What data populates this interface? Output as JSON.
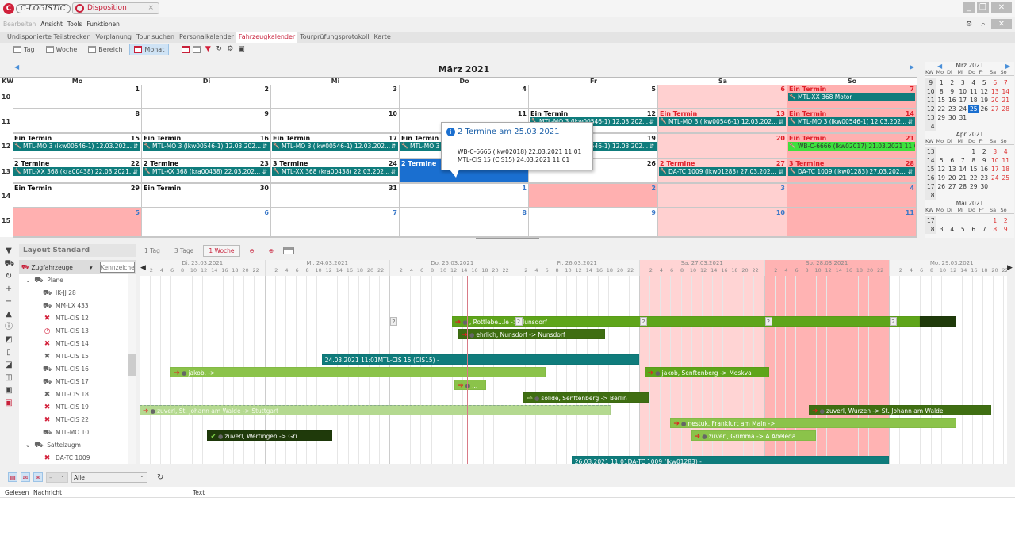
{
  "app": {
    "logo_text": "C-LOGISTIC",
    "document_tab": "Disposition",
    "close_glyph": "×"
  },
  "window_controls": {
    "minimize": "_",
    "restore": "❐",
    "close": "✕",
    "tab_close": "✕"
  },
  "menu": [
    "Bearbeiten",
    "Ansicht",
    "Tools",
    "Funktionen"
  ],
  "tabs": [
    "Undisponierte Teilstrecken",
    "Vorplanung",
    "Tour suchen",
    "Personalkalender",
    "Fahrzeugkalender",
    "Tourprüfungsprotokoll",
    "Karte"
  ],
  "active_tab": "Fahrzeugkalender",
  "toolbar": {
    "views": [
      "Tag",
      "Woche",
      "Bereich",
      "Monat"
    ],
    "active_view": "Monat"
  },
  "calendar": {
    "title": "März 2021",
    "kw_label": "KW",
    "weekdays": [
      "Mo",
      "Di",
      "Mi",
      "Do",
      "Fr",
      "Sa",
      "So"
    ],
    "weeks": [
      {
        "kw": "10",
        "days": [
          {
            "d": "1"
          },
          {
            "d": "2"
          },
          {
            "d": "3"
          },
          {
            "d": "4"
          },
          {
            "d": "5"
          },
          {
            "d": "6",
            "bg": "sat"
          },
          {
            "d": "7",
            "bg": "sun",
            "title": "Ein Termin",
            "event": "MTL-XX 368 Motor",
            "event_kind": "motor"
          }
        ]
      },
      {
        "kw": "11",
        "days": [
          {
            "d": "8"
          },
          {
            "d": "9"
          },
          {
            "d": "10"
          },
          {
            "d": "11"
          },
          {
            "d": "12",
            "title": "Ein Termin",
            "event": "MTL-MO 3 (lkw00546-1) 12.03.202..."
          },
          {
            "d": "13",
            "bg": "sat",
            "title": "Ein Termin",
            "event": "MTL-MO 3 (lkw00546-1) 12.03.202..."
          },
          {
            "d": "14",
            "bg": "sun",
            "title": "Ein Termin",
            "event": "MTL-MO 3 (lkw00546-1) 12.03.202..."
          }
        ]
      },
      {
        "kw": "12",
        "days": [
          {
            "d": "15",
            "title": "Ein Termin",
            "event": "MTL-MO 3 (lkw00546-1) 12.03.202..."
          },
          {
            "d": "16",
            "title": "Ein Termin",
            "event": "MTL-MO 3 (lkw00546-1) 12.03.202..."
          },
          {
            "d": "17",
            "title": "Ein Termin",
            "event": "MTL-MO 3 (lkw00546-1) 12.03.202..."
          },
          {
            "d": "18",
            "title": "Ein Termin",
            "event": "MTL-MO 3 (lkw00546-1) 12.03.202..."
          },
          {
            "d": "19",
            "event": "MTL-MO 3 (lkw00546-1) 12.03.202..."
          },
          {
            "d": "20",
            "bg": "sat"
          },
          {
            "d": "21",
            "bg": "sun",
            "title": "Ein Termin",
            "event": "WB-C-6666 (lkw02017) 21.03.2021 11:0",
            "event_kind": "green"
          }
        ]
      },
      {
        "kw": "13",
        "days": [
          {
            "d": "22",
            "title": "2 Termine",
            "event": "MTL-XX 368 (kra00438) 22.03.2021..."
          },
          {
            "d": "23",
            "title": "2 Termine",
            "event": "MTL-XX 368 (kra00438) 22.03.202..."
          },
          {
            "d": "24",
            "title": "3 Termine",
            "event": "MTL-XX 368 (kra00438) 22.03.202..."
          },
          {
            "d": "25",
            "bg": "selected",
            "title": "2 Termine"
          },
          {
            "d": "26"
          },
          {
            "d": "27",
            "bg": "sat",
            "title": "2 Termine",
            "event": "DA-TC 1009 (lkw01283) 27.03.202..."
          },
          {
            "d": "28",
            "bg": "sun",
            "title": "3 Termine",
            "event": "DA-TC 1009 (lkw01283) 27.03.202..."
          }
        ]
      },
      {
        "kw": "14",
        "days": [
          {
            "d": "29",
            "title": "Ein Termin"
          },
          {
            "d": "30",
            "title": "Ein Termin"
          },
          {
            "d": "31"
          },
          {
            "d": "1",
            "other": true
          },
          {
            "d": "2",
            "other": true,
            "bg": "holiday"
          },
          {
            "d": "3",
            "other": true,
            "bg": "sat"
          },
          {
            "d": "4",
            "other": true,
            "bg": "sun"
          }
        ]
      },
      {
        "kw": "15",
        "days": [
          {
            "d": "5",
            "other": true,
            "bg": "holiday"
          },
          {
            "d": "6",
            "other": true
          },
          {
            "d": "7",
            "other": true
          },
          {
            "d": "8",
            "other": true
          },
          {
            "d": "9",
            "other": true
          },
          {
            "d": "10",
            "other": true,
            "bg": "sat"
          },
          {
            "d": "11",
            "other": true,
            "bg": "sun"
          }
        ]
      }
    ]
  },
  "tooltip": {
    "title": "2 Termine am 25.03.2021",
    "lines": [
      "WB-C-6666 (lkw02018) 22.03.2021 11:01",
      "MTL-CIS 15 (CIS15) 24.03.2021 11:01"
    ]
  },
  "mini_calendar": {
    "weekday_header": [
      "KW",
      "Mo",
      "Di",
      "Mi",
      "Do",
      "Fr",
      "Sa",
      "So"
    ],
    "months": [
      {
        "title": "Mrz 2021",
        "weeks": [
          [
            "9",
            "1",
            "2",
            "3",
            "4",
            "5",
            "6",
            "7"
          ],
          [
            "10",
            "8",
            "9",
            "10",
            "11",
            "12",
            "13",
            "14"
          ],
          [
            "11",
            "15",
            "16",
            "17",
            "18",
            "19",
            "20",
            "21"
          ],
          [
            "12",
            "22",
            "23",
            "24",
            "25",
            "26",
            "27",
            "28"
          ],
          [
            "13",
            "29",
            "30",
            "31",
            "",
            "",
            "",
            ""
          ],
          [
            "14",
            "",
            "",
            "",
            "",
            "",
            "",
            ""
          ]
        ],
        "selected": "25"
      },
      {
        "title": "Apr 2021",
        "weeks": [
          [
            "13",
            "",
            "",
            "",
            "1",
            "2",
            "3",
            "4"
          ],
          [
            "14",
            "5",
            "6",
            "7",
            "8",
            "9",
            "10",
            "11"
          ],
          [
            "15",
            "12",
            "13",
            "14",
            "15",
            "16",
            "17",
            "18"
          ],
          [
            "16",
            "19",
            "20",
            "21",
            "22",
            "23",
            "24",
            "25"
          ],
          [
            "17",
            "26",
            "27",
            "28",
            "29",
            "30",
            "",
            ""
          ],
          [
            "18",
            "",
            "",
            "",
            "",
            "",
            "",
            ""
          ]
        ]
      },
      {
        "title": "Mai 2021",
        "weeks": [
          [
            "17",
            "",
            "",
            "",
            "",
            "",
            "1",
            "2"
          ],
          [
            "18",
            "3",
            "4",
            "5",
            "6",
            "7",
            "8",
            "9"
          ]
        ]
      }
    ]
  },
  "gantt": {
    "layout_title": "Layout Standard",
    "zoom_options": [
      "1 Tag",
      "3 Tage",
      "1 Woche"
    ],
    "active_zoom": "1 Woche",
    "vehicle_type": "Zugfahrzeuge",
    "search_placeholder": "Kennzeichen",
    "tree": [
      {
        "label": "Plane",
        "level": 0,
        "icon": "truck-group"
      },
      {
        "label": "IK-JJ 28",
        "level": 1,
        "icon": "truck"
      },
      {
        "label": "MM-LX 433",
        "level": 1,
        "icon": "truck"
      },
      {
        "label": "MTL-CIS 12",
        "level": 1,
        "icon": "tools-red"
      },
      {
        "label": "MTL-CIS 13",
        "level": 1,
        "icon": "clock-red"
      },
      {
        "label": "MTL-CIS 14",
        "level": 1,
        "icon": "tools-red"
      },
      {
        "label": "MTL-CIS 15",
        "level": 1,
        "icon": "tools"
      },
      {
        "label": "MTL-CIS 16",
        "level": 1,
        "icon": "truck"
      },
      {
        "label": "MTL-CIS 17",
        "level": 1,
        "icon": "truck"
      },
      {
        "label": "MTL-CIS 18",
        "level": 1,
        "icon": "tools"
      },
      {
        "label": "MTL-CIS 19",
        "level": 1,
        "icon": "tools-red"
      },
      {
        "label": "MTL-CIS 22",
        "level": 1,
        "icon": "tools-red"
      },
      {
        "label": "MTL-MO 10",
        "level": 1,
        "icon": "truck"
      },
      {
        "label": "Sattelzugm",
        "level": 0,
        "icon": "truck-group"
      },
      {
        "label": "DA-TC 1009",
        "level": 1,
        "icon": "tools-red"
      }
    ],
    "days": [
      {
        "label": "Di. 23.03.2021",
        "kind": "work"
      },
      {
        "label": "Mi. 24.03.2021",
        "kind": "work"
      },
      {
        "label": "Do. 25.03.2021",
        "kind": "work"
      },
      {
        "label": "Fr. 26.03.2021",
        "kind": "work"
      },
      {
        "label": "Sa. 27.03.2021",
        "kind": "sat"
      },
      {
        "label": "So. 28.03.2021",
        "kind": "sun"
      },
      {
        "label": "Mo. 29.03.2021",
        "kind": "work"
      }
    ],
    "hour_ticks": [
      "2",
      "4",
      "6",
      "8",
      "10",
      "12",
      "14",
      "16",
      "18",
      "20",
      "22"
    ],
    "now_hour": 63,
    "bars": [
      {
        "row": 3,
        "start": 60,
        "end": 150,
        "label": ", Rottlebe...le -> Nunsdorf",
        "style": "mid",
        "arrow": "➔"
      },
      {
        "row": 3,
        "start": 150,
        "end": 157,
        "label": "",
        "style": "black"
      },
      {
        "row": 4,
        "start": 61.3,
        "end": 89.4,
        "label": "ehrlich, Nunsdorf -> Nunsdorf",
        "style": "dark",
        "arrow": "➔"
      },
      {
        "row": 6,
        "start": 35,
        "end": 96,
        "label": "24.03.2021 11:01MTL-CIS 15 (CIS15) -",
        "style": "teal"
      },
      {
        "row": 7,
        "start": 6,
        "end": 78,
        "label": "jakob,  ->",
        "style": "light",
        "arrow": "➔"
      },
      {
        "row": 7,
        "start": 97,
        "end": 121,
        "label": "jakob, Senftenberg -> Moskva",
        "style": "mid",
        "arrow": "➔"
      },
      {
        "row": 8,
        "start": 60.5,
        "end": 66.6,
        "label": "...",
        "style": "light",
        "arrow": "➔"
      },
      {
        "row": 9,
        "start": 73.8,
        "end": 97.8,
        "label": "solide, Senftenberg -> Berlin",
        "style": "dark",
        "arrow": "⇨"
      },
      {
        "row": 10,
        "start": 0,
        "end": 90.5,
        "label": "zuverl, St. Johann am Walde -> Stuttgart",
        "style": "faded",
        "arrow": "➔"
      },
      {
        "row": 10,
        "start": 128.6,
        "end": 163.6,
        "label": "zuverl, Wurzen -> St. Johann am Walde",
        "style": "dark",
        "arrow": "➔"
      },
      {
        "row": 11,
        "start": 102,
        "end": 157,
        "label": "nestuk, Frankfurt am Main ->",
        "style": "light",
        "arrow": "➔"
      },
      {
        "row": 12,
        "start": 13,
        "end": 37,
        "label": "zuverl, Wertingen -> Gri...",
        "style": "black",
        "arrow": "✔"
      },
      {
        "row": 12,
        "start": 106,
        "end": 130,
        "label": "zuverl, Grimma -> A Abeleda",
        "style": "light",
        "arrow": "➔"
      },
      {
        "row": 14,
        "start": 83,
        "end": 144,
        "label": "26.03.2021 11:01DA-TC 1009 (lkw01283) -",
        "style": "teal"
      }
    ],
    "badges": [
      {
        "row": 3,
        "hour": 48,
        "text": "2"
      },
      {
        "row": 3,
        "hour": 72,
        "text": "2"
      },
      {
        "row": 3,
        "hour": 96,
        "text": "2"
      },
      {
        "row": 3,
        "hour": 120,
        "text": "2"
      },
      {
        "row": 3,
        "hour": 144,
        "text": "2"
      }
    ]
  },
  "messages": {
    "filter_dash": "–",
    "filter_value": "Alle",
    "columns": [
      "Gelesen",
      "Nachricht",
      "Text"
    ]
  },
  "colors": {
    "accent": "#c8203a",
    "teal": "#0f7c7c",
    "selected": "#1a6fd0",
    "sat": "#ffd0d0",
    "sun": "#ffb0b0"
  }
}
